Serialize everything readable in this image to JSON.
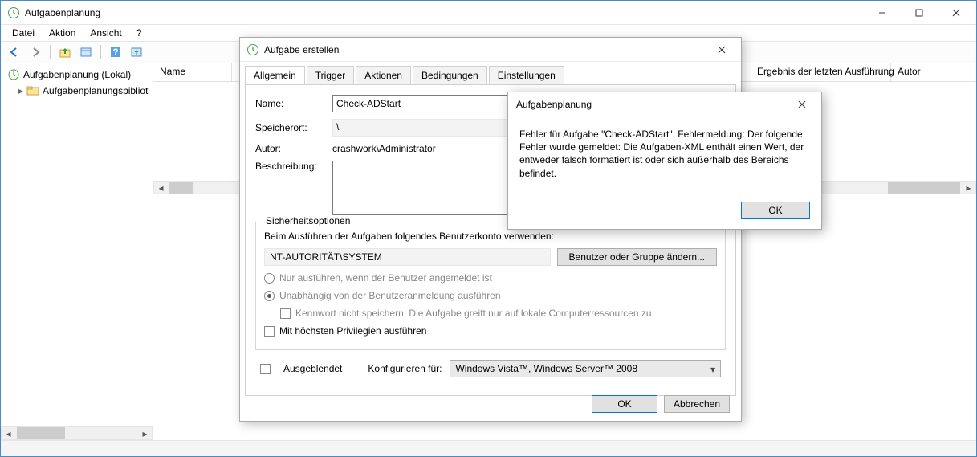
{
  "main_window": {
    "title": "Aufgabenplanung",
    "menu": {
      "file": "Datei",
      "action": "Aktion",
      "view": "Ansicht",
      "help": "?"
    },
    "tree": {
      "root": "Aufgabenplanung (Lokal)",
      "library": "Aufgabenplanungsbibliot"
    },
    "list_columns": {
      "name": "Name",
      "last_result": "Ergebnis der letzten Ausführung",
      "author": "Autor"
    }
  },
  "create_dialog": {
    "title": "Aufgabe erstellen",
    "tabs": {
      "general": "Allgemein",
      "trigger": "Trigger",
      "actions": "Aktionen",
      "conditions": "Bedingungen",
      "settings": "Einstellungen"
    },
    "labels": {
      "name": "Name:",
      "location": "Speicherort:",
      "author": "Autor:",
      "description": "Beschreibung:"
    },
    "values": {
      "name": "Check-ADStart",
      "location": "\\",
      "author": "crashwork\\Administrator"
    },
    "security": {
      "group_title": "Sicherheitsoptionen",
      "prompt": "Beim Ausführen der Aufgaben folgendes Benutzerkonto verwenden:",
      "account": "NT-AUTORITÄT\\SYSTEM",
      "change_btn": "Benutzer oder Gruppe ändern...",
      "radio_logged_on": "Nur ausführen, wenn der Benutzer angemeldet ist",
      "radio_any": "Unabhängig von der Benutzeranmeldung ausführen",
      "chk_nopass": "Kennwort nicht speichern. Die Aufgabe greift nur auf lokale Computerressourcen zu.",
      "chk_highest": "Mit höchsten Privilegien ausführen"
    },
    "footer": {
      "hidden": "Ausgeblendet",
      "configure_for": "Konfigurieren für:",
      "configure_value": "Windows Vista™, Windows Server™ 2008",
      "ok": "OK",
      "cancel": "Abbrechen"
    }
  },
  "error_box": {
    "title": "Aufgabenplanung",
    "message": "Fehler für Aufgabe \"Check-ADStart\". Fehlermeldung: Der folgende Fehler wurde gemeldet: Die Aufgaben-XML enthält einen Wert, der entweder falsch formatiert ist oder sich außerhalb des Bereichs befindet.",
    "ok": "OK"
  }
}
